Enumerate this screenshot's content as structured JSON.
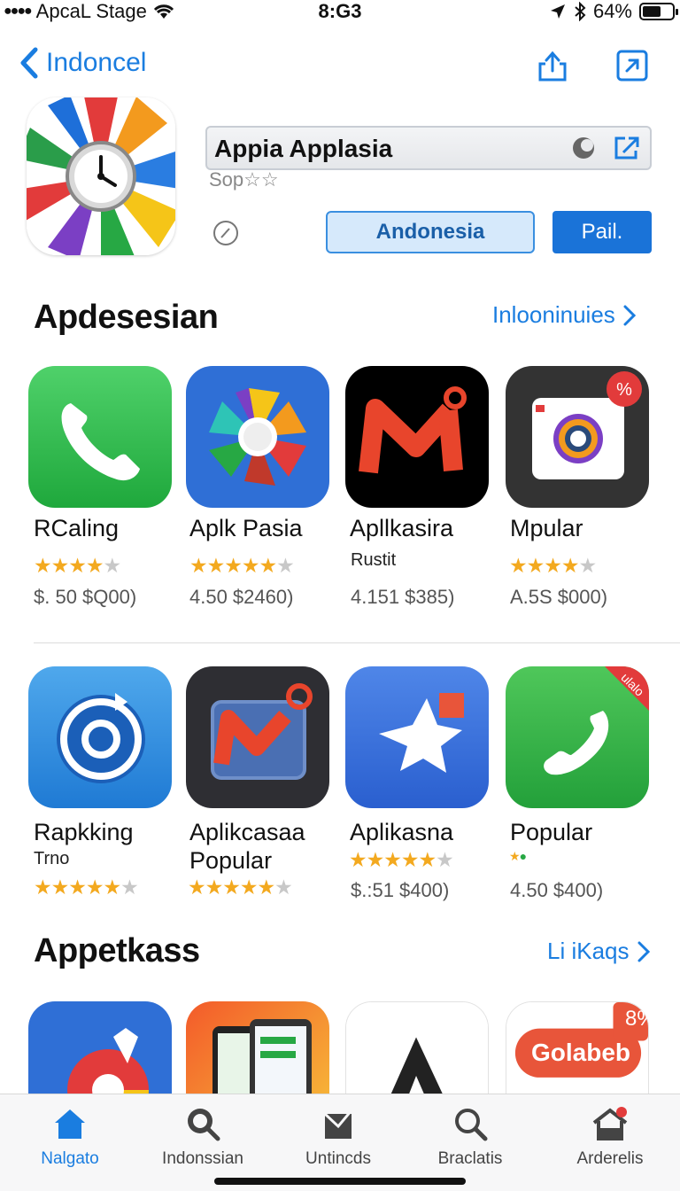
{
  "status_bar": {
    "carrier": "ApcaL Stage",
    "time": "8:G3",
    "battery": "64%",
    "battery_level": 0.64
  },
  "nav": {
    "back_label": "Indoncel",
    "share_icon": "share-icon",
    "open_icon": "open-external-icon"
  },
  "app": {
    "title": "Appia Applasia",
    "subtitle": "Sop☆☆",
    "region_button": "Andonesia",
    "get_button": "Pail.",
    "icon": "clock-wheel-icon"
  },
  "section1": {
    "title": "Apdesesian",
    "link": "Inlooninuies"
  },
  "row1": [
    {
      "name": "RCaling",
      "rating": 4,
      "price": "$. 50 $Q00)",
      "icon": "phone-icon"
    },
    {
      "name": "Aplk Pasia",
      "rating": 4.5,
      "price": "4.50 $2460)",
      "icon": "photos-icon"
    },
    {
      "name": "Apllkasira",
      "sub": "Rustit",
      "price": "4.151 $385)",
      "icon": "mail-icon"
    },
    {
      "name": "Mpular",
      "rating": 4,
      "price": "A.5S $000)",
      "icon": "camera-icon",
      "badge": "%"
    }
  ],
  "row2": [
    {
      "name": "Rapkking",
      "sub": "Trno",
      "rating": 4.5,
      "icon": "target-icon"
    },
    {
      "name": "Aplikcasaa",
      "name2": "Popular",
      "rating": 4.5,
      "icon": "mail-icon"
    },
    {
      "name": "Aplikasna",
      "rating": 4.5,
      "price": "$.:51 $400)",
      "icon": "star-icon"
    },
    {
      "name": "Popular",
      "price": "4.50 $400)",
      "icon": "phone-icon",
      "badge": "ulalo"
    }
  ],
  "section2": {
    "title": "Appetkass",
    "link": "Li iKaqs"
  },
  "row3": [
    {
      "icon": "browser-icon"
    },
    {
      "icon": "devices-icon"
    },
    {
      "icon": "letter-a-icon"
    },
    {
      "label": "Golabeb",
      "badge": "8%",
      "icon": "badge-icon"
    }
  ],
  "tabs": [
    {
      "label": "Nalgato",
      "icon": "home-icon",
      "active": true
    },
    {
      "label": "Indonssian",
      "icon": "search-icon"
    },
    {
      "label": "Untincds",
      "icon": "inbox-icon"
    },
    {
      "label": "Braclatis",
      "icon": "search-icon"
    },
    {
      "label": "Arderelis",
      "icon": "house-icon"
    }
  ]
}
